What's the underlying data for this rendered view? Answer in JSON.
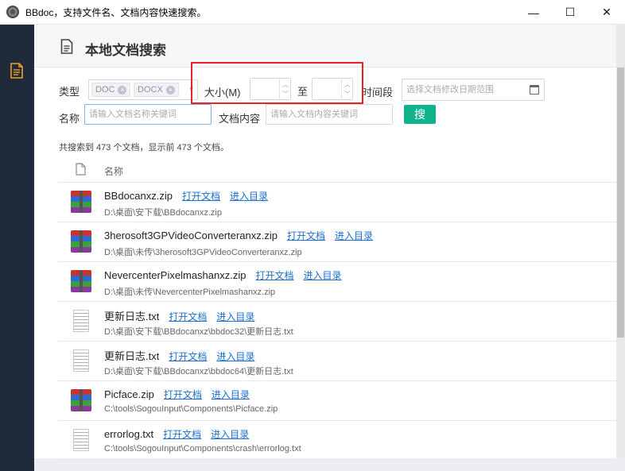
{
  "window": {
    "title": "BBdoc，支持文件名、文档内容快速搜索。",
    "minimize_glyph": "—",
    "maximize_glyph": "☐",
    "close_glyph": "✕"
  },
  "nav": {
    "icon": "document-icon"
  },
  "header": {
    "title": "本地文档搜索"
  },
  "filters": {
    "type_label": "类型",
    "type_tags": [
      "DOC",
      "DOCX"
    ],
    "size_label": "大小(M)",
    "size_to_label": "至",
    "size_from_value": "",
    "size_to_value": "",
    "time_label": "时间段",
    "time_placeholder": "选择文档修改日期范围",
    "name_label": "名称",
    "name_placeholder": "请输入文档名称关键词",
    "content_label": "文档内容",
    "content_placeholder": "请输入文档内容关键词",
    "search_label": "搜"
  },
  "summary": "共搜索到 473 个文档，显示前 473 个文档。",
  "list": {
    "name_header": "名称",
    "open_label": "打开文档",
    "dir_label": "进入目录",
    "rows": [
      {
        "type": "zip",
        "name": "BBdocanxz.zip",
        "path": "D:\\桌面\\安下载\\BBdocanxz.zip"
      },
      {
        "type": "zip",
        "name": "3herosoft3GPVideoConverteranxz.zip",
        "path": "D:\\桌面\\未传\\3herosoft3GPVideoConverteranxz.zip"
      },
      {
        "type": "zip",
        "name": "NevercenterPixelmashanxz.zip",
        "path": "D:\\桌面\\未传\\NevercenterPixelmashanxz.zip"
      },
      {
        "type": "txt",
        "name": "更新日志.txt",
        "path": "D:\\桌面\\安下载\\BBdocanxz\\bbdoc32\\更新日志.txt"
      },
      {
        "type": "txt",
        "name": "更新日志.txt",
        "path": "D:\\桌面\\安下载\\BBdocanxz\\bbdoc64\\更新日志.txt"
      },
      {
        "type": "zip",
        "name": "Picface.zip",
        "path": "C:\\tools\\SogouInput\\Components\\Picface.zip"
      },
      {
        "type": "txt",
        "name": "errorlog.txt",
        "path": "C:\\tools\\SogouInput\\Components\\crash\\errorlog.txt"
      }
    ]
  },
  "colors": {
    "nav_bg": "#1f2a3a",
    "nav_icon": "#f0a020",
    "accent": "#13b28f",
    "link": "#1a6fd1",
    "highlight": "#e8212a"
  }
}
